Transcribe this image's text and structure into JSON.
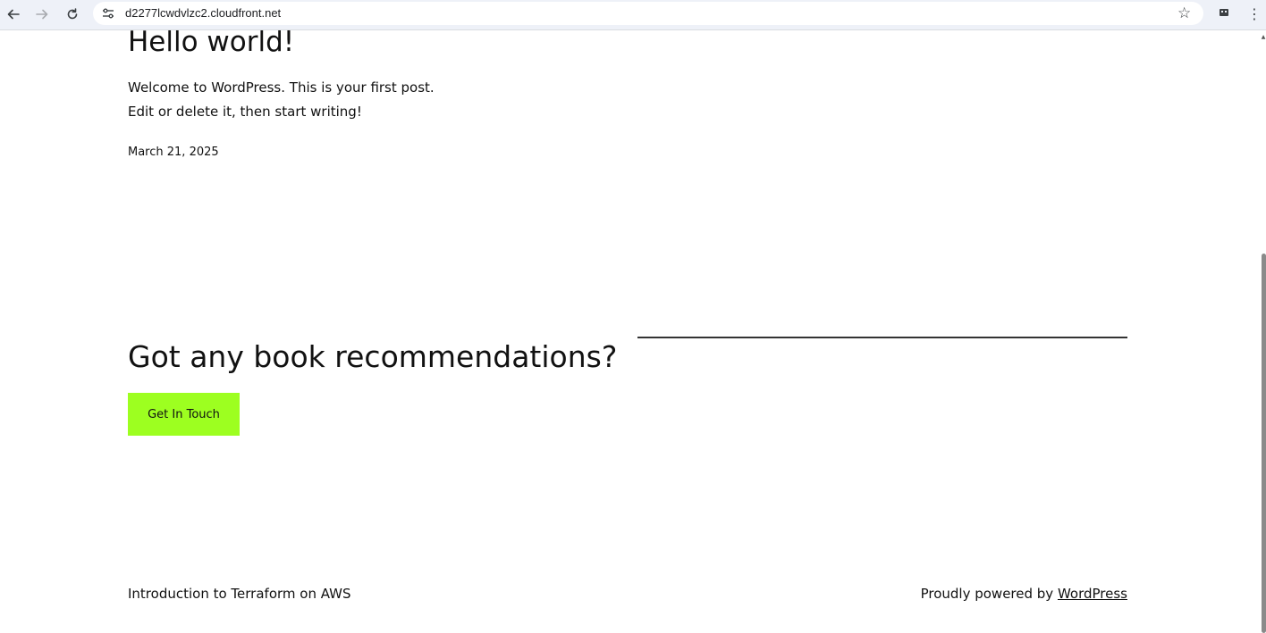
{
  "browser": {
    "url": "d2277lcwdvlzc2.cloudfront.net",
    "icons": {
      "back": "back-arrow-icon",
      "forward": "forward-arrow-icon",
      "reload": "reload-icon",
      "site_info": "site-settings-icon",
      "bookmark": "star-icon",
      "extension": "extension-icon",
      "menu": "three-dot-menu-icon"
    }
  },
  "post": {
    "title": "Hello world!",
    "line1": "Welcome to WordPress. This is your first post.",
    "line2": "Edit or delete it, then start writing!",
    "date": "March 21, 2025"
  },
  "cta": {
    "heading": "Got any book recommendations?",
    "button_label": "Get In Touch",
    "button_color": "#9dff20"
  },
  "footer": {
    "site_title": "Introduction to Terraform on AWS",
    "powered_prefix": "Proudly powered by ",
    "powered_link": "WordPress"
  }
}
